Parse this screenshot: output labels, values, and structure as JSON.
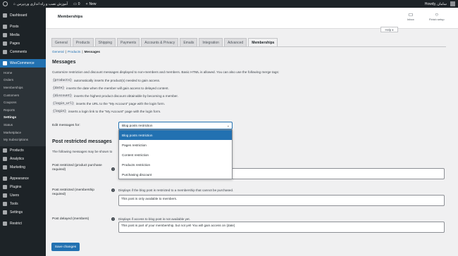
{
  "adminbar": {
    "site_name": "آموزش نصب و راه اندازی وردپرس",
    "comments_count": "0",
    "updates_count": "0",
    "new_label": "New",
    "howdy": "Howdy, سامان"
  },
  "sidebar": {
    "items_top": [
      {
        "label": "Dashboard"
      },
      {
        "label": "Posts"
      },
      {
        "label": "Media"
      },
      {
        "label": "Pages"
      },
      {
        "label": "Comments"
      }
    ],
    "woocommerce": "WooCommerce",
    "submenu": [
      "Home",
      "Orders",
      "Memberships",
      "Customers",
      "Coupons",
      "Reports",
      "Settings",
      "Status",
      "Marketplace",
      "My Subscriptions"
    ],
    "items_bottom": [
      {
        "label": "Products"
      },
      {
        "label": "Analytics"
      },
      {
        "label": "Marketing"
      },
      {
        "label": "Appearance"
      },
      {
        "label": "Plugins"
      },
      {
        "label": "Users"
      },
      {
        "label": "Tools"
      },
      {
        "label": "Settings"
      },
      {
        "label": "Restrict"
      }
    ]
  },
  "header": {
    "title": "Memberships",
    "inbox": "Inbox",
    "finish_setup": "Finish setup",
    "help": "Help ▾"
  },
  "tabs": [
    "General",
    "Products",
    "Shipping",
    "Payments",
    "Accounts & Privacy",
    "Emails",
    "Integration",
    "Advanced",
    "Memberships"
  ],
  "active_tab": "Memberships",
  "subsub": {
    "general": "General",
    "products": "Products",
    "messages": "Messages"
  },
  "messages": {
    "heading": "Messages",
    "intro": "Customize restriction and discount messages displayed to non-members and members. Basic HTML is allowed. You can also use the following merge tags:",
    "tags": [
      {
        "code": "{products}",
        "desc": "automatically inserts the product(s) needed to gain access."
      },
      {
        "code": "{date}",
        "desc": "inserts the date when the member will gain access to delayed content."
      },
      {
        "code": "{discount}",
        "desc": "inserts the highest product discount obtainable by becoming a member."
      },
      {
        "code": "{login_url}",
        "desc": "inserts the URL to the \"My Account\" page with the login form."
      },
      {
        "code": "{login}",
        "desc": "inserts a login link to the \"My Account\" page with the login form."
      }
    ],
    "edit_label": "Edit messages for:",
    "selected": "Blog posts restriction",
    "options": [
      "Blog posts restriction",
      "Pages restriction",
      "Content restriction",
      "Products restriction",
      "Purchasing discount"
    ]
  },
  "post_restricted": {
    "heading": "Post restricted messages",
    "desc": "The following messages may be shown to",
    "fields": [
      {
        "label": "Post restricted (product purchase required)",
        "desc": "",
        "value": ""
      },
      {
        "label": "Post restricted (membership required)",
        "desc": "Displays if the blog post is restricted to a membership that cannot be purchased.",
        "value": "This post is only available to members."
      },
      {
        "label": "Post delayed (members)",
        "desc": "Displays if access to blog post is not available yet.",
        "value": "This post is part of your membership, but not yet! You will gain access on {date}"
      }
    ]
  },
  "save_button": "Save changes"
}
